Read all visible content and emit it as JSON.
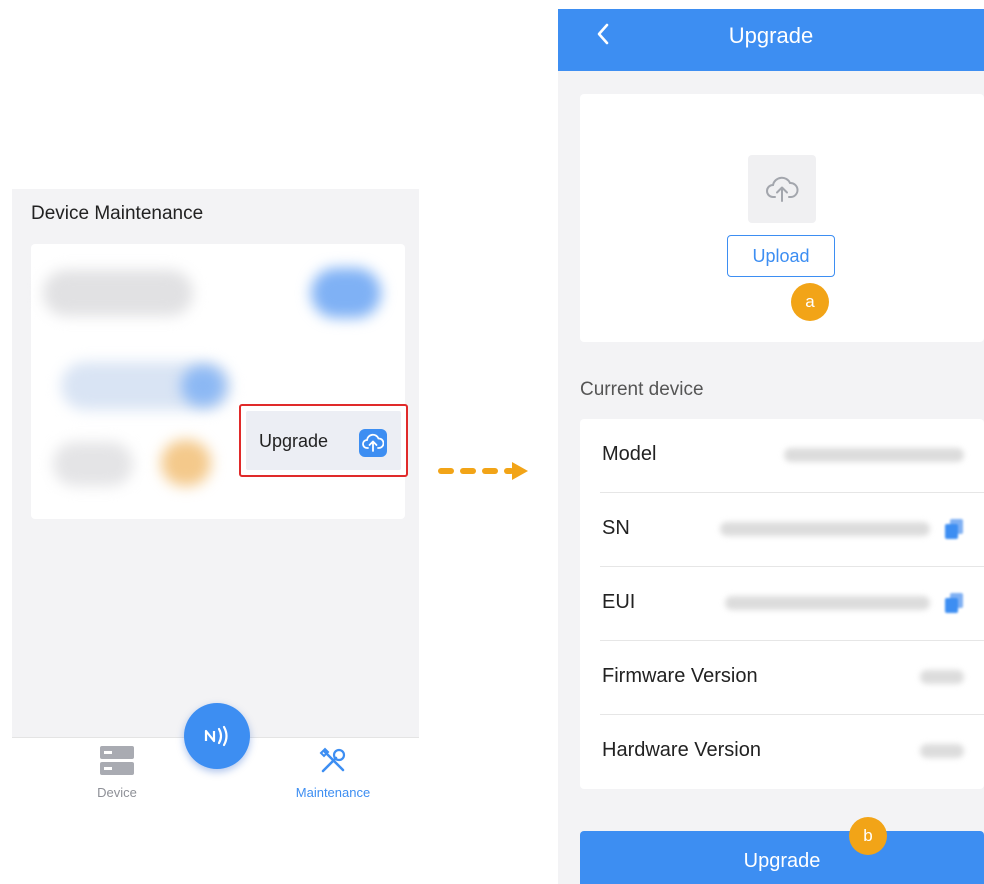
{
  "left": {
    "title": "Device Maintenance",
    "upgrade_entry_label": "Upgrade",
    "nav": [
      {
        "label": "Device",
        "icon": "server-icon",
        "active": false
      },
      {
        "label": "Maintenance",
        "icon": "tools-icon",
        "active": true
      }
    ],
    "nfc_icon": "nfc-icon",
    "highlight_color": "#e02a2a"
  },
  "right": {
    "header_title": "Upgrade",
    "upload_label": "Upload",
    "marker_a": "a",
    "marker_b": "b",
    "section_title": "Current device",
    "rows": [
      {
        "label": "Model",
        "copyable": false
      },
      {
        "label": "SN",
        "copyable": true
      },
      {
        "label": "EUI",
        "copyable": true
      },
      {
        "label": "Firmware Version",
        "copyable": false
      },
      {
        "label": "Hardware Version",
        "copyable": false
      }
    ],
    "upgrade_button_label": "Upgrade"
  },
  "colors": {
    "accent": "#3d8ef2",
    "marker": "#f2a417",
    "arrow": "#f2a417"
  }
}
